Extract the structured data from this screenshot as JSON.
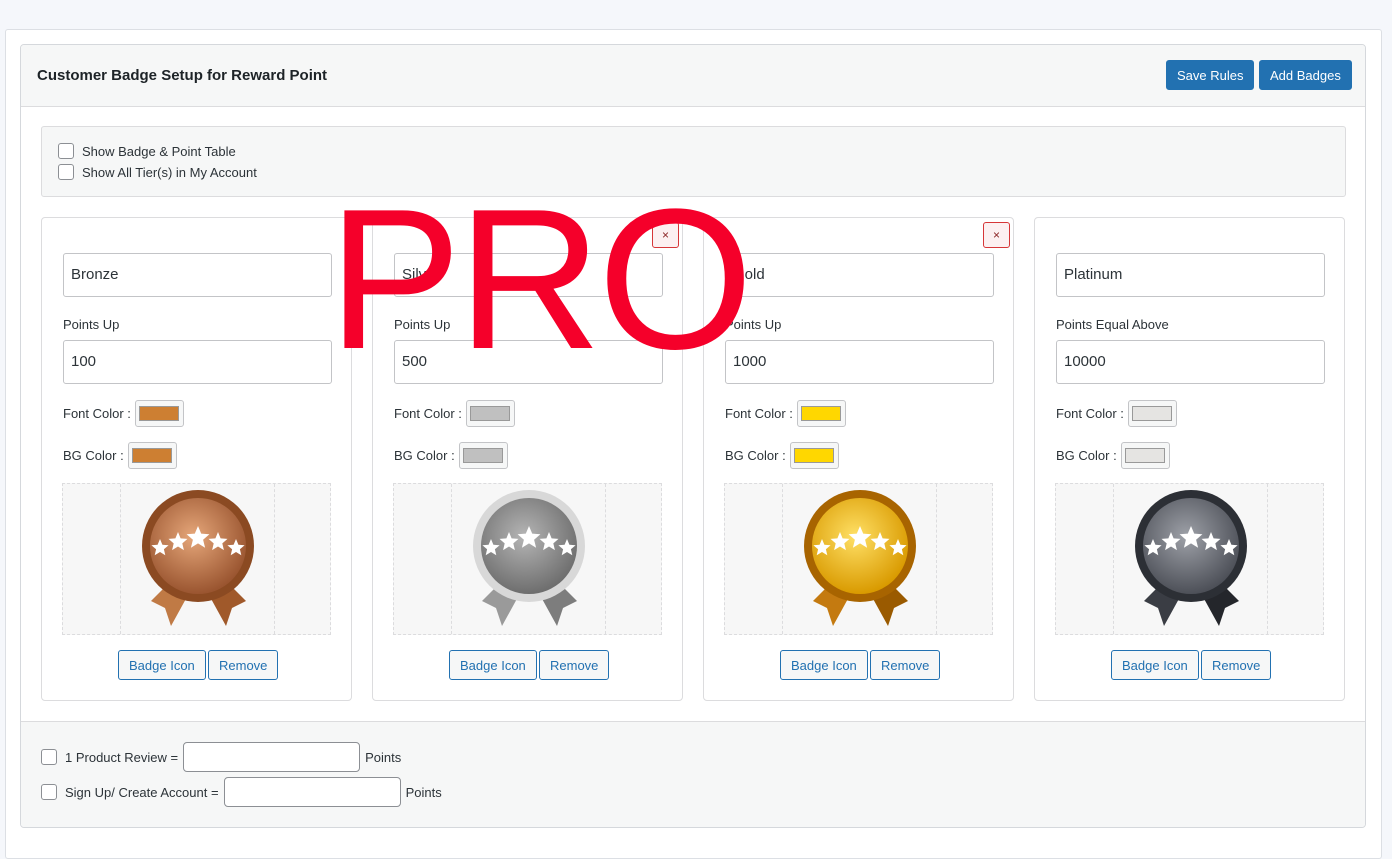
{
  "header": {
    "title": "Customer Badge Setup for Reward Point",
    "save_label": "Save Rules",
    "add_label": "Add Badges"
  },
  "options": {
    "show_table": "Show Badge & Point Table",
    "show_tiers": "Show All Tier(s) in My Account"
  },
  "font_color_label": "Font Color :",
  "bg_color_label": "BG Color :",
  "badge_icon_label": "Badge Icon",
  "remove_label": "Remove",
  "close_glyph": "×",
  "badges": [
    {
      "name": "Bronze",
      "points_label": "Points Up",
      "points": "100",
      "font_color": "#cd7f32",
      "bg_color": "#cd7f32",
      "medal": "bronze-medal-icon",
      "closable": false
    },
    {
      "name": "Silver",
      "points_label": "Points Up",
      "points": "500",
      "font_color": "#c0c0c0",
      "bg_color": "#c0c0c0",
      "medal": "silver-medal-icon",
      "closable": true
    },
    {
      "name": "Gold",
      "points_label": "Points Up",
      "points": "1000",
      "font_color": "#ffd700",
      "bg_color": "#ffd700",
      "medal": "gold-medal-icon",
      "closable": true
    },
    {
      "name": "Platinum",
      "points_label": "Points Equal Above",
      "points": "10000",
      "font_color": "#e5e4e2",
      "bg_color": "#e5e4e2",
      "medal": "platinum-medal-icon",
      "closable": false
    }
  ],
  "footer": {
    "review_label": "1 Product Review =",
    "signup_label": "Sign Up/ Create Account =",
    "points_suffix": "Points"
  },
  "watermark": "PRO"
}
